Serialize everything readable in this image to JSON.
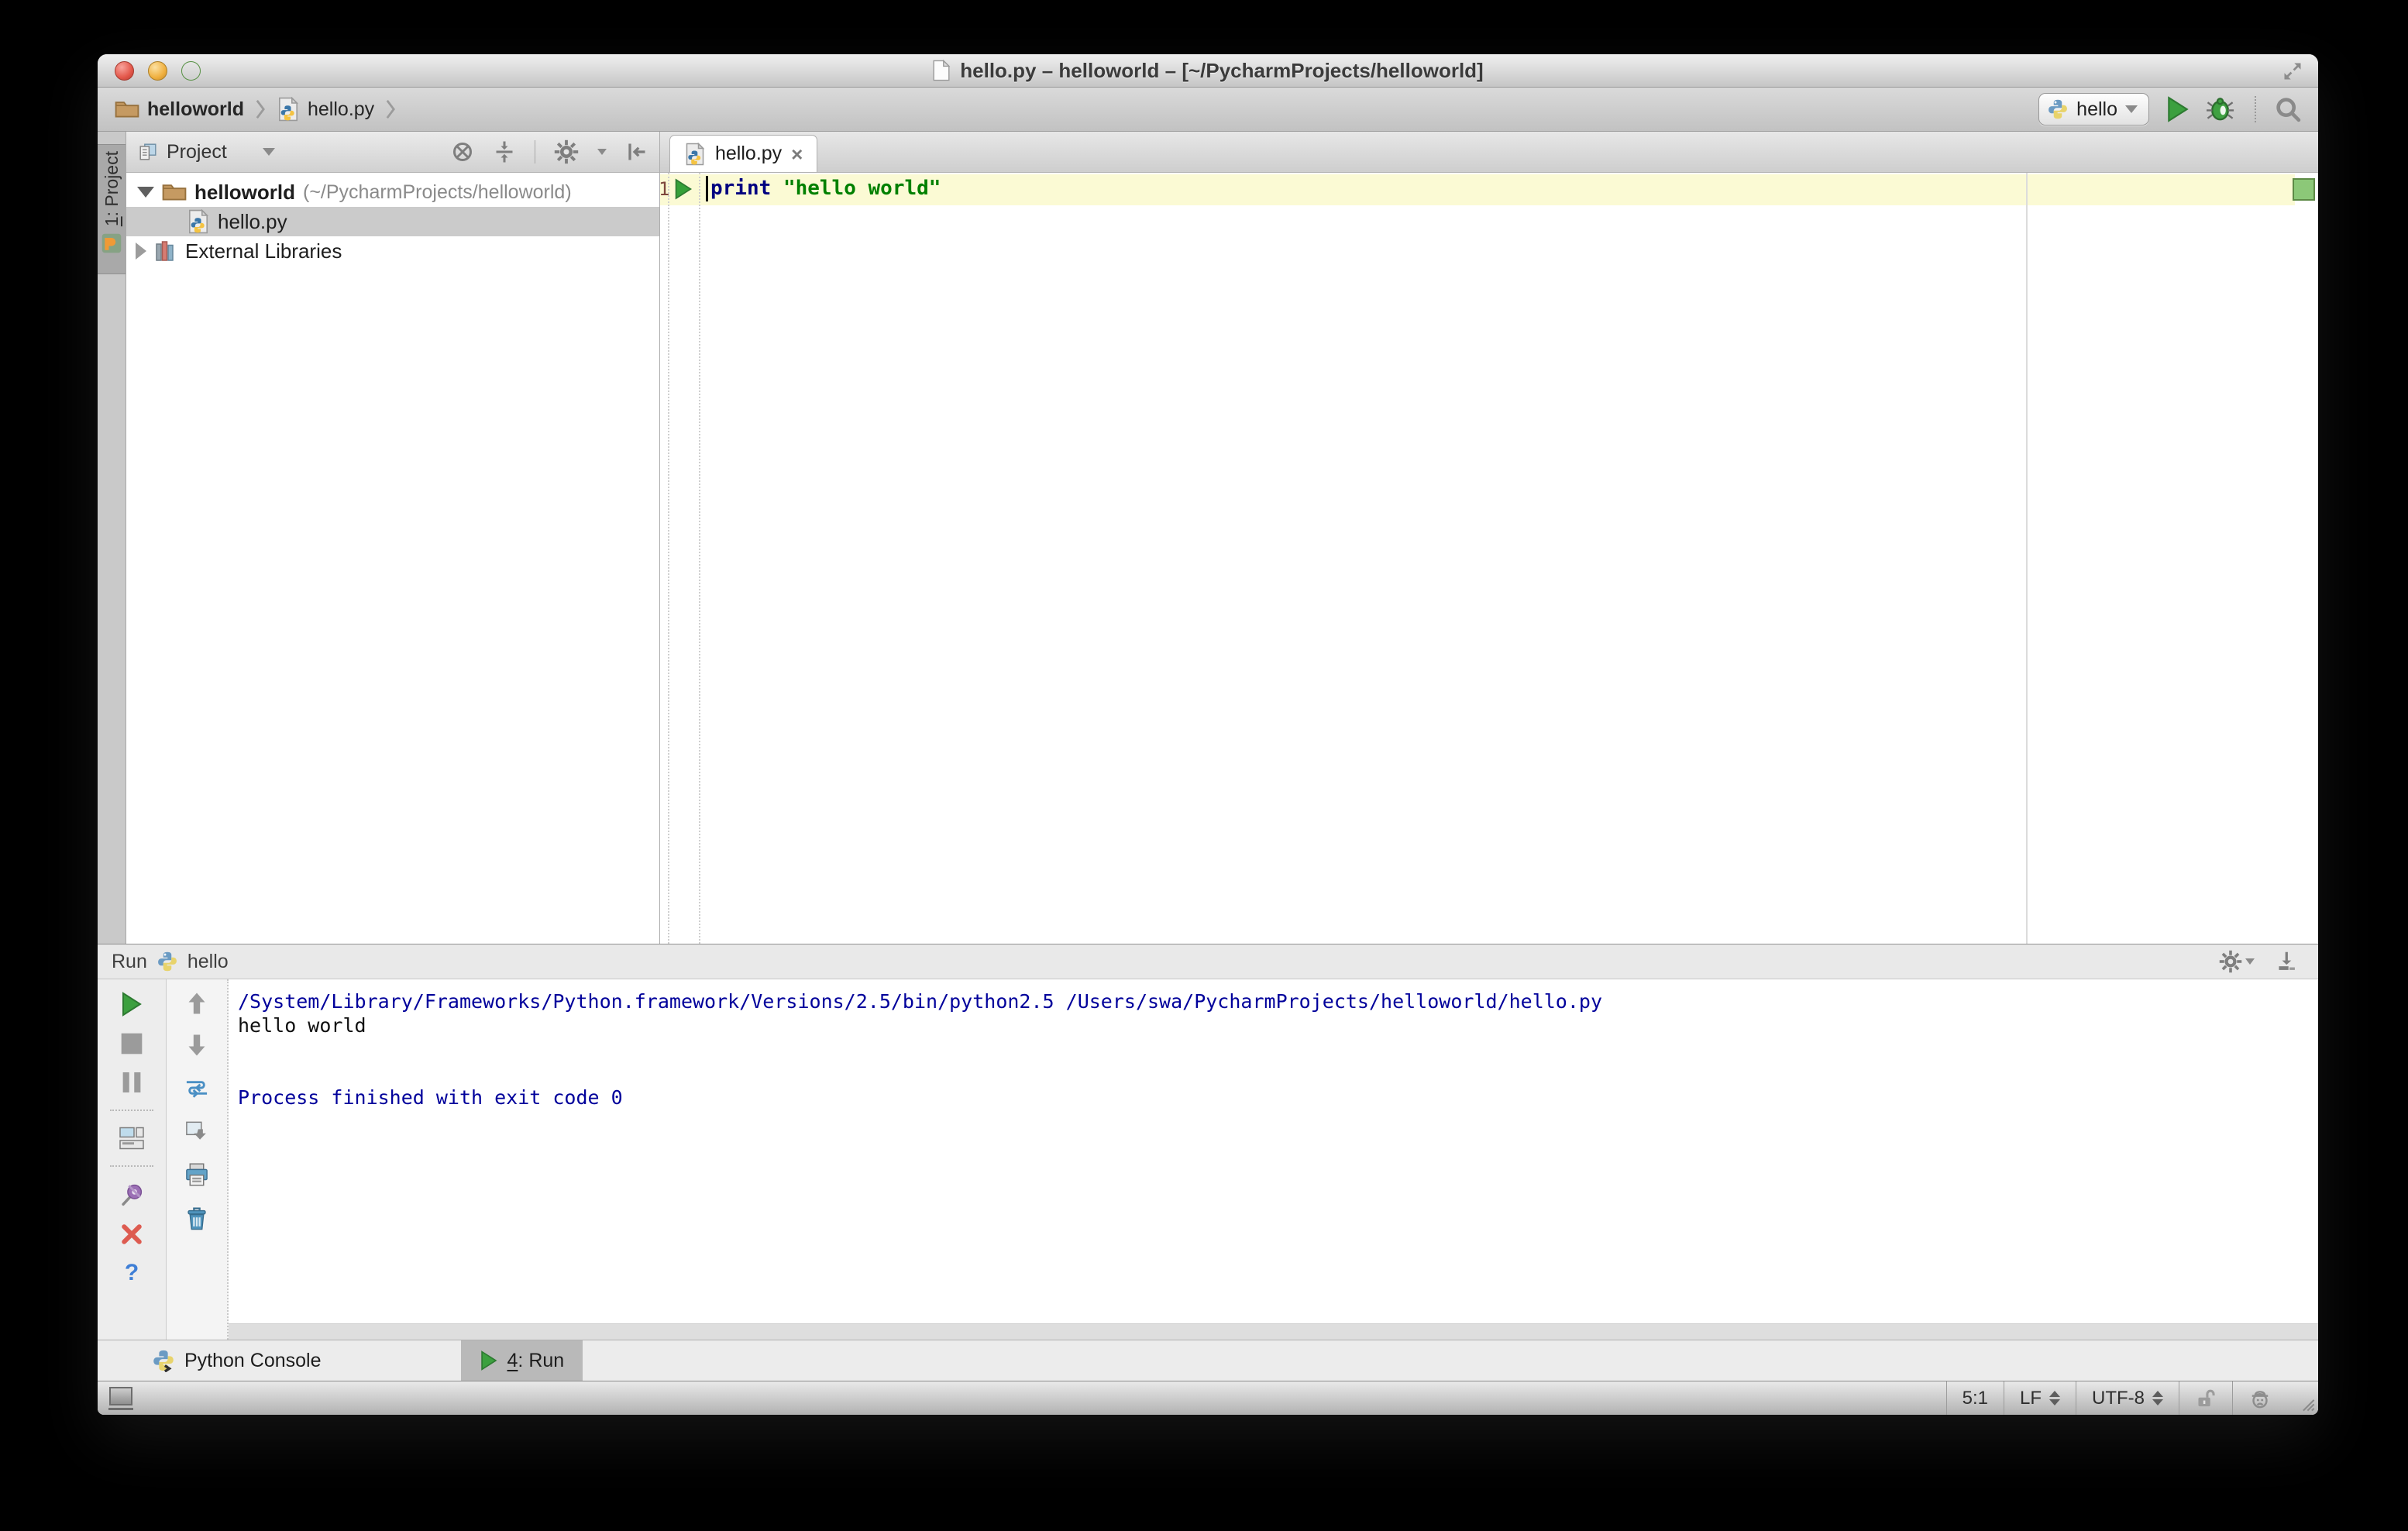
{
  "window": {
    "title": "hello.py – helloworld – [~/PycharmProjects/helloworld]"
  },
  "navbar": {
    "breadcrumb_project": "helloworld",
    "breadcrumb_file": "hello.py",
    "run_config": "hello"
  },
  "project_panel": {
    "header_title": "Project",
    "stripe_number": "1",
    "stripe_rest": ": Project",
    "tree": {
      "root_label": "helloworld",
      "root_path": "(~/PycharmProjects/helloworld)",
      "file_label": "hello.py",
      "libraries_label": "External Libraries"
    }
  },
  "editor": {
    "tab_label": "hello.py",
    "line_number": "1",
    "code_keyword": "print",
    "code_string": "\"hello world\""
  },
  "run_panel": {
    "title": "Run",
    "config_name": "hello",
    "console_lines": [
      "/System/Library/Frameworks/Python.framework/Versions/2.5/bin/python2.5 /Users/swa/PycharmProjects/helloworld/hello.py",
      "hello world",
      "",
      "",
      "Process finished with exit code 0"
    ]
  },
  "bottom_bar": {
    "python_console_label": "Python Console",
    "run_tab_number": "4",
    "run_tab_rest": ": Run"
  },
  "status_bar": {
    "caret_position": "5:1",
    "line_ending": "LF",
    "encoding": "UTF-8"
  },
  "colors": {
    "keyword": "#000080",
    "string": "#008000",
    "console_system": "#00009b",
    "current_line_highlight": "#fbfad4",
    "run_green": "#3ca03f",
    "selection_gray": "#cbcbcb"
  }
}
